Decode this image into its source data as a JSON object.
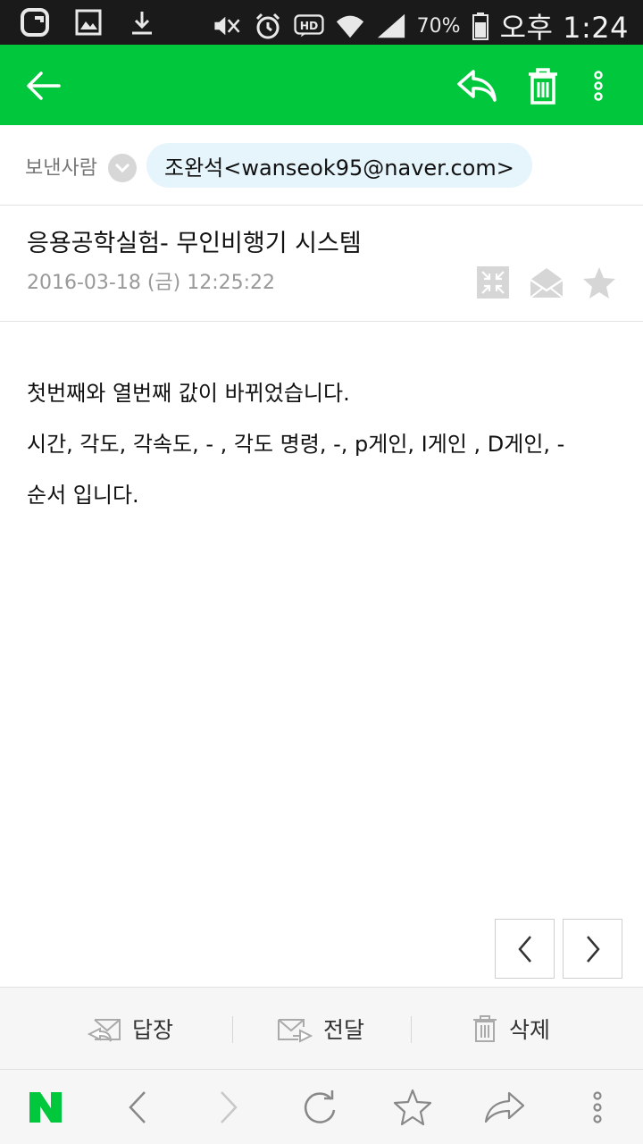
{
  "status_bar": {
    "battery_percent": "70%",
    "time": "오후 1:24",
    "icons": [
      "g-app-icon",
      "gallery-icon",
      "download-icon",
      "mute-icon",
      "alarm-icon",
      "hd-voice-icon",
      "wifi-icon",
      "signal-icon",
      "battery-icon"
    ]
  },
  "app_bar": {
    "accent_color": "#00c73c",
    "icons": [
      "back-arrow-icon",
      "reply-icon",
      "trash-icon",
      "more-vertical-icon"
    ]
  },
  "sender": {
    "label": "보낸사람",
    "address": "조완석<wanseok95@naver.com>"
  },
  "mail": {
    "subject": "응용공학실험- 무인비행기 시스템",
    "date": "2016-03-18 (금) 12:25:22",
    "icons": [
      "collapse-icon",
      "open-envelope-icon",
      "star-icon"
    ],
    "body": [
      "첫번째와 열번째 값이 바뀌었습니다.",
      "시간, 각도, 각속도, - , 각도 명령, -, p게인, I게인 , D게인, -",
      "순서 입니다."
    ]
  },
  "actions": {
    "reply": "답장",
    "forward": "전달",
    "delete": "삭제"
  },
  "toolbar": {
    "icons": [
      "naver-n-icon",
      "back-icon",
      "forward-icon",
      "refresh-icon",
      "bookmark-star-icon",
      "share-icon",
      "more-vertical-icon"
    ]
  }
}
